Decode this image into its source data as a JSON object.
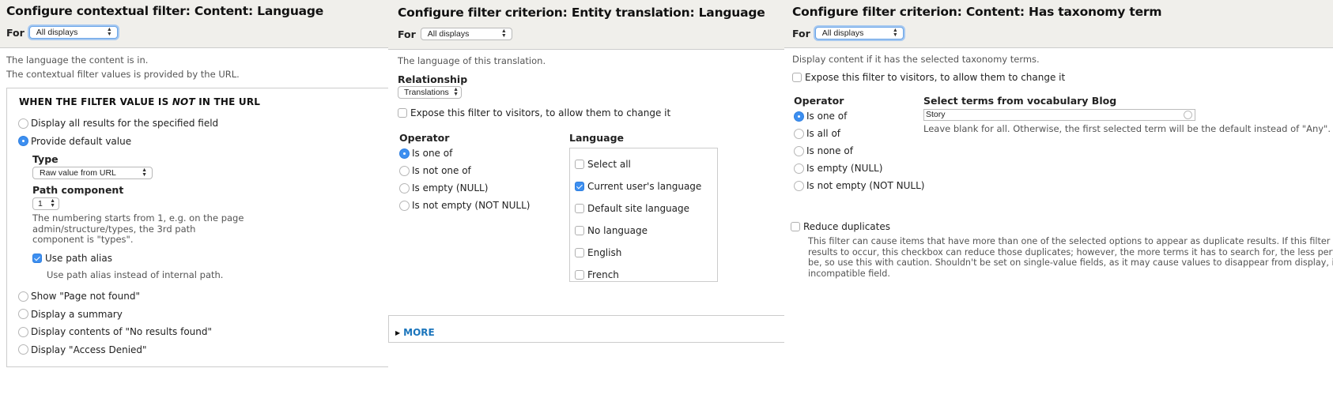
{
  "panels": [
    {
      "title": "Configure contextual filter: Content: Language",
      "for_label": "For",
      "for_select": "All displays",
      "descriptions": [
        "The language the content is in.",
        "The contextual filter values is provided by the URL."
      ],
      "fieldset": {
        "legend_pre": "WHEN THE FILTER VALUE IS ",
        "legend_em": "NOT",
        "legend_post": " IN THE URL",
        "options_top": [
          {
            "label": "Display all results for the specified field",
            "checked": false
          },
          {
            "label": "Provide default value",
            "checked": true
          }
        ],
        "type_label": "Type",
        "type_select": "Raw value from URL",
        "path_label": "Path component",
        "path_select": "1",
        "path_help": [
          "The numbering starts from 1, e.g. on the page",
          "admin/structure/types, the 3rd path",
          "component is \"types\"."
        ],
        "alias_label": "Use path alias",
        "alias_checked": true,
        "alias_help": "Use path alias instead of internal path.",
        "options_bottom": [
          {
            "label": "Show \"Page not found\"",
            "checked": false
          },
          {
            "label": "Display a summary",
            "checked": false
          },
          {
            "label": "Display contents of \"No results found\"",
            "checked": false
          },
          {
            "label": "Display \"Access Denied\"",
            "checked": false
          }
        ]
      }
    },
    {
      "title": "Configure filter criterion: Entity translation: Language",
      "for_label": "For",
      "for_select": "All displays",
      "description": "The language of this translation.",
      "relationship_label": "Relationship",
      "relationship_select": "Translations",
      "expose_label": "Expose this filter to visitors, to allow them to change it",
      "operator_label": "Operator",
      "operators": [
        {
          "label": "Is one of",
          "checked": true
        },
        {
          "label": "Is not one of",
          "checked": false
        },
        {
          "label": "Is empty (NULL)",
          "checked": false
        },
        {
          "label": "Is not empty (NOT NULL)",
          "checked": false
        }
      ],
      "language_label": "Language",
      "languages": [
        {
          "label": "Select all",
          "checked": false
        },
        {
          "label": "Current user's language",
          "checked": true
        },
        {
          "label": "Default site language",
          "checked": false
        },
        {
          "label": "No language",
          "checked": false
        },
        {
          "label": "English",
          "checked": false
        },
        {
          "label": "French",
          "checked": false
        }
      ],
      "more_label": "MORE"
    },
    {
      "title": "Configure filter criterion: Content: Has taxonomy term",
      "for_label": "For",
      "for_select": "All displays",
      "description": "Display content if it has the selected taxonomy terms.",
      "expose_label": "Expose this filter to visitors, to allow them to change it",
      "operator_label": "Operator",
      "operators": [
        {
          "label": "Is one of",
          "checked": true
        },
        {
          "label": "Is all of",
          "checked": false
        },
        {
          "label": "Is none of",
          "checked": false
        },
        {
          "label": "Is empty (NULL)",
          "checked": false
        },
        {
          "label": "Is not empty (NOT NULL)",
          "checked": false
        }
      ],
      "terms_label": "Select terms from vocabulary Blog",
      "terms_value": "Story",
      "terms_help": "Leave blank for all. Otherwise, the first selected term will be the default instead of \"Any\".",
      "reduce_label": "Reduce duplicates",
      "reduce_help": [
        "This filter can cause items that have more than one of the selected options to appear as duplicate results. If this filter causes duplicate",
        "results to occur, this checkbox can reduce those duplicates; however, the more terms it has to search for, the less performant the query will",
        "be, so use this with caution. Shouldn't be set on single-value fields, as it may cause values to disappear from display, if used on an",
        "incompatible field."
      ]
    }
  ]
}
